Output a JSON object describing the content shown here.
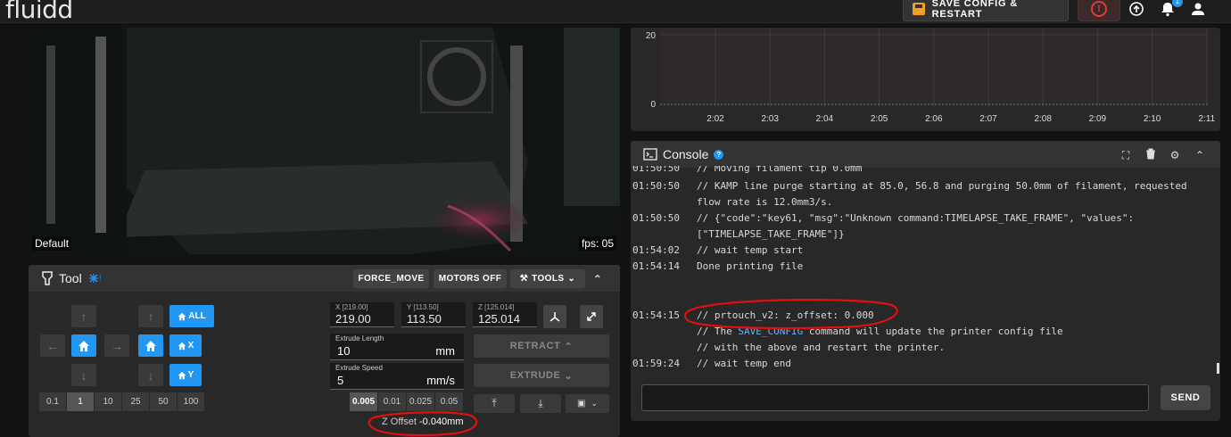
{
  "app": {
    "logo": "fluidd"
  },
  "topbar": {
    "save_config_label": "SAVE CONFIG & RESTART",
    "notification_count": "1"
  },
  "camera": {
    "name": "Default",
    "fps": "fps: 05"
  },
  "tool": {
    "title": "Tool",
    "force_move": "FORCE_MOVE",
    "motors_off": "MOTORS OFF",
    "tools": "TOOLS",
    "home_all": "ALL",
    "home_x": "X",
    "home_y": "Y",
    "step_sizes": [
      "0.1",
      "1",
      "10",
      "25",
      "50",
      "100"
    ],
    "selected_step": "1",
    "position": {
      "x_label": "X [219.00]",
      "x_value": "219.00",
      "y_label": "Y [113.50]",
      "y_value": "113.50",
      "z_label": "Z [125.014]",
      "z_value": "125.014"
    },
    "extrude_length": {
      "label": "Extrude Length",
      "value": "10",
      "unit": "mm"
    },
    "extrude_speed": {
      "label": "Extrude Speed",
      "value": "5",
      "unit": "mm/s"
    },
    "retract": "RETRACT",
    "extrude": "EXTRUDE",
    "z_distances": [
      "0.005",
      "0.01",
      "0.025",
      "0.05"
    ],
    "selected_z_distance": "0.005",
    "z_offset_label": "Z Offset",
    "z_offset_value": "-0.040mm"
  },
  "chart": {
    "y_ticks": [
      "20",
      "0"
    ],
    "x_ticks": [
      "2:02",
      "2:03",
      "2:04",
      "2:05",
      "2:06",
      "2:07",
      "2:08",
      "2:09",
      "2:10",
      "2:11"
    ]
  },
  "console": {
    "title": "Console",
    "entries": [
      {
        "time": "01:50:50",
        "text": "// Moving filament tip 0.0mm"
      },
      {
        "time": "01:50:50",
        "text": "// KAMP line purge starting at 85.0, 56.8 and purging 50.0mm of filament, requested flow rate is 12.0mm3/s."
      },
      {
        "time": "01:50:50",
        "text": "// {\"code\":\"key61, \"msg\":\"Unknown command:TIMELAPSE_TAKE_FRAME\", \"values\": [\"TIMELAPSE_TAKE_FRAME\"]}"
      },
      {
        "time": "01:54:02",
        "text": "// wait temp start"
      },
      {
        "time": "01:54:14",
        "text": "Done printing file"
      },
      {
        "time": "01:54:15",
        "text": "// prtouch_v2: z_offset: 0.000"
      },
      {
        "time": "",
        "text_pre": "// The ",
        "keyword": "SAVE_CONFIG",
        "text_post": " command will update the printer config file"
      },
      {
        "time": "",
        "text": "// with the above and restart the printer."
      },
      {
        "time": "01:59:24",
        "text": "// wait temp end"
      }
    ],
    "send_label": "SEND"
  },
  "colors": {
    "accent": "#2196f3",
    "save_icon": "#f0a020",
    "estop": "#e53935",
    "annotation": "#e01010"
  }
}
